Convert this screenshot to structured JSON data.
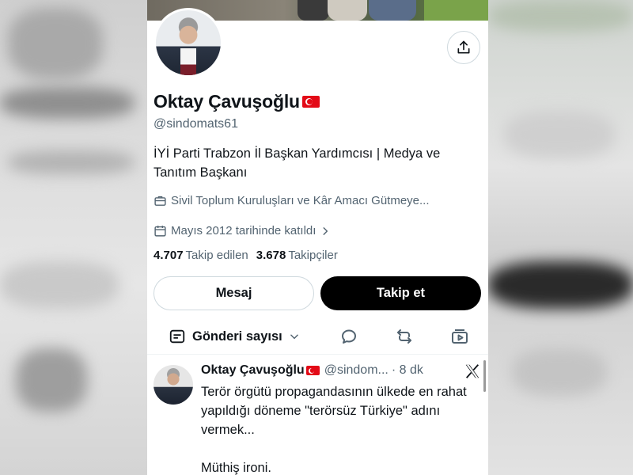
{
  "profile": {
    "name": "Oktay Çavuşoğlu",
    "handle": "@sindomats61",
    "bio": "İYİ Parti Trabzon İl Başkan Yardımcısı | Medya ve Tanıtım Başkanı",
    "category": "Sivil Toplum Kuruluşları ve Kâr Amacı Gütmeye...",
    "joined": "Mayıs 2012 tarihinde katıldı",
    "following_count": "4.707",
    "following_label": "Takip edilen",
    "followers_count": "3.678",
    "followers_label": "Takipçiler"
  },
  "actions": {
    "message_label": "Mesaj",
    "follow_label": "Takip et"
  },
  "tabs": {
    "posts_label": "Gönderi sayısı"
  },
  "post": {
    "author": "Oktay Çavuşoğlu",
    "handle": "@sindom...",
    "time": "· 8 dk",
    "text": "Terör örgütü propagandasının ülkede en rahat yapıldığı döneme \"terörsüz Türkiye\" adını vermek...\n\nMüthiş ironi."
  },
  "icons": {
    "share": "share-icon",
    "briefcase": "briefcase-icon",
    "calendar": "calendar-icon",
    "chevron": "chevron-right-icon",
    "posts": "posts-icon",
    "replies": "reply-icon",
    "reposts": "repost-icon",
    "media": "media-icon",
    "x_logo": "x-logo-icon",
    "flag": "turkey-flag-icon"
  },
  "colors": {
    "text_primary": "#0f1419",
    "text_secondary": "#536471",
    "follow_bg": "#000000",
    "border": "#cfd9de",
    "flag_red": "#e30a17"
  }
}
